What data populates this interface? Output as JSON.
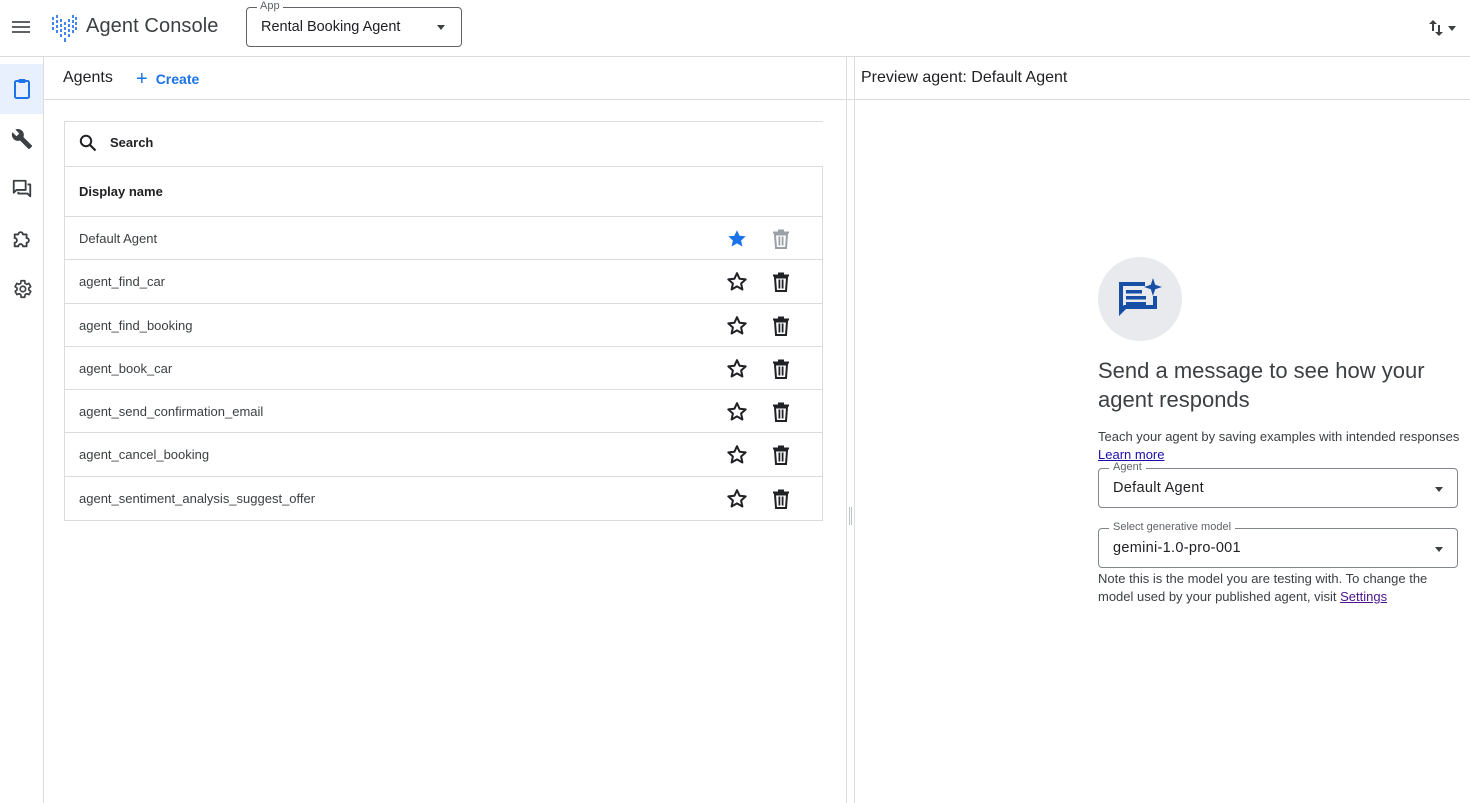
{
  "header": {
    "app_title": "Agent Console",
    "app_select": {
      "label": "App",
      "value": "Rental Booking Agent"
    }
  },
  "rail": {
    "items": [
      {
        "name": "clipboard-icon",
        "active": true
      },
      {
        "name": "wrench-icon",
        "active": false
      },
      {
        "name": "chat-icon",
        "active": false
      },
      {
        "name": "extension-icon",
        "active": false
      },
      {
        "name": "gear-icon",
        "active": false
      }
    ]
  },
  "agents": {
    "title": "Agents",
    "create_label": "Create",
    "search_placeholder": "Search",
    "column_header": "Display name",
    "rows": [
      {
        "name": "Default Agent",
        "starred": true,
        "delete_disabled": true
      },
      {
        "name": "agent_find_car",
        "starred": false,
        "delete_disabled": false
      },
      {
        "name": "agent_find_booking",
        "starred": false,
        "delete_disabled": false
      },
      {
        "name": "agent_book_car",
        "starred": false,
        "delete_disabled": false
      },
      {
        "name": "agent_send_confirmation_email",
        "starred": false,
        "delete_disabled": false
      },
      {
        "name": "agent_cancel_booking",
        "starred": false,
        "delete_disabled": false
      },
      {
        "name": "agent_sentiment_analysis_suggest_offer",
        "starred": false,
        "delete_disabled": false
      }
    ]
  },
  "preview": {
    "title": "Preview agent: Default Agent",
    "headline": "Send a message to see how your agent responds",
    "teach_text": "Teach your agent by saving examples with intended responses",
    "learn_more": "Learn more",
    "agent_select": {
      "label": "Agent",
      "value": "Default Agent"
    },
    "model_select": {
      "label": "Select generative model",
      "value": "gemini-1.0-pro-001"
    },
    "note_text": "Note this is the model you are testing with. To change the model used by your published agent, visit",
    "settings_link": "Settings"
  },
  "colors": {
    "accent": "#1a73e8",
    "active_rail_bg": "#e8f0fe",
    "star_filled": "#1a73e8",
    "chat_icon": "#174ea6"
  }
}
